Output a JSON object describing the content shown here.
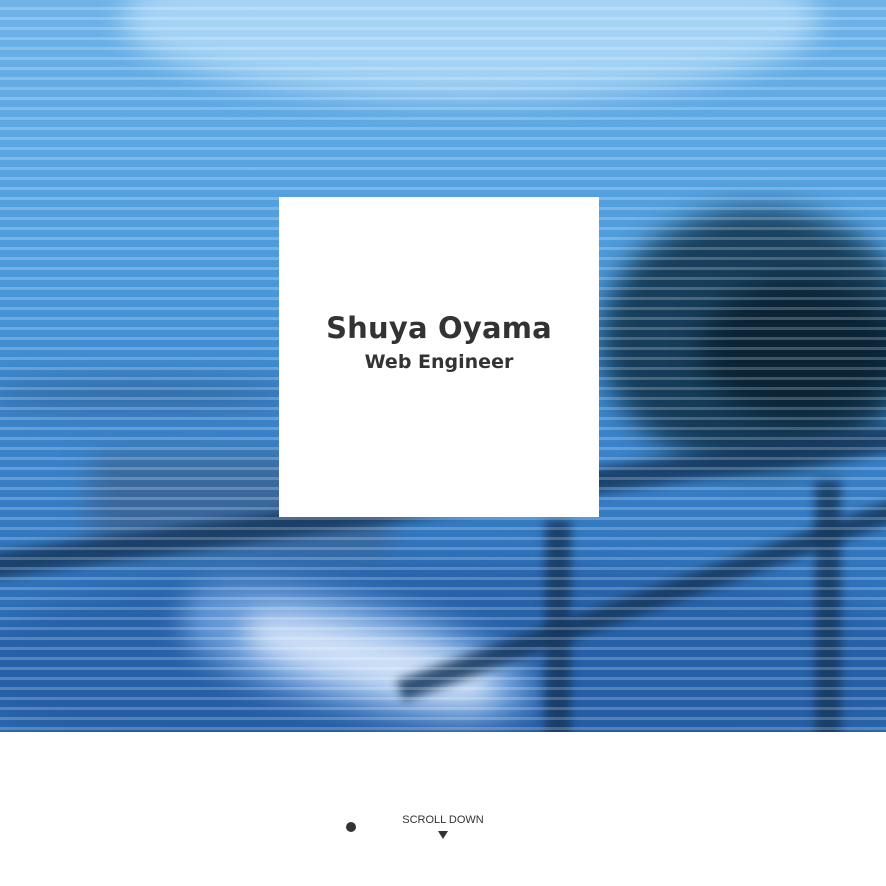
{
  "hero": {
    "image": "harbour-boat-photo",
    "accent_color": "#3f8bd1",
    "stripe_color": "#ffffff"
  },
  "profile": {
    "name": "Shuya Oyama",
    "role": "Web Engineer"
  },
  "scroll": {
    "label": "SCROLL DOWN",
    "icon": "triangle-down-icon"
  },
  "indicator": {
    "icon": "dot-icon",
    "color": "#333333"
  }
}
